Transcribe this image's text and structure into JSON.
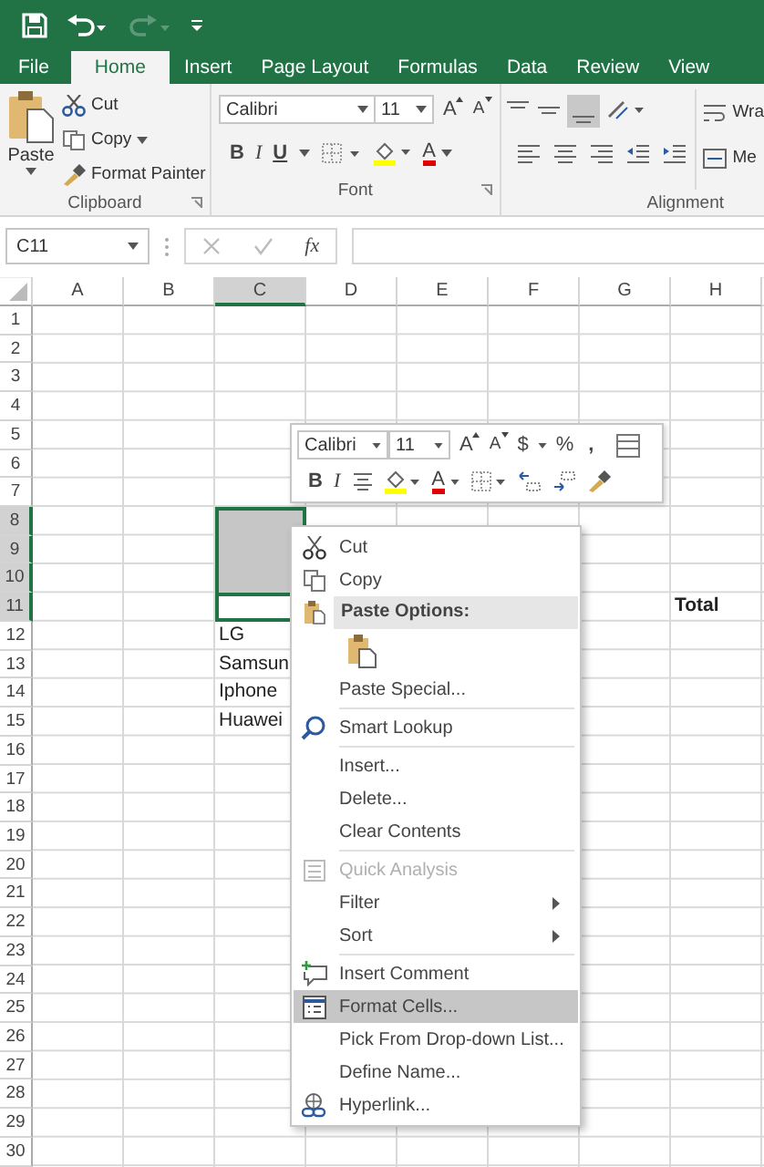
{
  "tabs": [
    {
      "label": "File",
      "selected": false
    },
    {
      "label": "Home",
      "selected": true
    },
    {
      "label": "Insert",
      "selected": false
    },
    {
      "label": "Page Layout",
      "selected": false
    },
    {
      "label": "Formulas",
      "selected": false
    },
    {
      "label": "Data",
      "selected": false
    },
    {
      "label": "Review",
      "selected": false
    },
    {
      "label": "View",
      "selected": false
    }
  ],
  "ribbon": {
    "clipboard": {
      "paste": "Paste",
      "cut": "Cut",
      "copy": "Copy",
      "format_painter": "Format Painter",
      "label": "Clipboard"
    },
    "font": {
      "font_name": "Calibri",
      "font_size": "11",
      "grow": "A",
      "shrink": "A",
      "bold": "B",
      "italic": "I",
      "underline": "U",
      "font_color": "A",
      "label": "Font"
    },
    "alignment": {
      "wrap": "Wra",
      "merge": "Me",
      "label": "Alignment"
    }
  },
  "formula_bar": {
    "name_box": "C11",
    "function": "fx"
  },
  "sheet": {
    "columns": [
      {
        "label": "A",
        "selected": false
      },
      {
        "label": "B",
        "selected": false
      },
      {
        "label": "C",
        "selected": true
      },
      {
        "label": "D",
        "selected": false
      },
      {
        "label": "E",
        "selected": false
      },
      {
        "label": "F",
        "selected": false
      },
      {
        "label": "G",
        "selected": false
      },
      {
        "label": "H",
        "selected": false
      }
    ],
    "rows": [
      {
        "number": "1",
        "selected": false
      },
      {
        "number": "2",
        "selected": false
      },
      {
        "number": "3",
        "selected": false
      },
      {
        "number": "4",
        "selected": false
      },
      {
        "number": "5",
        "selected": false
      },
      {
        "number": "6",
        "selected": false
      },
      {
        "number": "7",
        "selected": false
      },
      {
        "number": "8",
        "selected": true,
        "active": false
      },
      {
        "number": "9",
        "selected": true,
        "active": false
      },
      {
        "number": "10",
        "selected": true,
        "active": false
      },
      {
        "number": "11",
        "selected": true,
        "active": true,
        "cells": {
          "h": {
            "text": "Total",
            "bold": true
          }
        }
      },
      {
        "number": "12",
        "selected": false,
        "cells": {
          "c": {
            "text": "LG",
            "bold": false
          }
        }
      },
      {
        "number": "13",
        "selected": false,
        "cells": {
          "c": {
            "text": "Samsun",
            "bold": false
          }
        }
      },
      {
        "number": "14",
        "selected": false,
        "cells": {
          "c": {
            "text": "Iphone",
            "bold": false
          }
        }
      },
      {
        "number": "15",
        "selected": false,
        "cells": {
          "c": {
            "text": "Huawei",
            "bold": false
          }
        }
      },
      {
        "number": "16",
        "selected": false
      },
      {
        "number": "17",
        "selected": false
      },
      {
        "number": "18",
        "selected": false
      },
      {
        "number": "19",
        "selected": false
      },
      {
        "number": "20",
        "selected": false
      },
      {
        "number": "21",
        "selected": false
      },
      {
        "number": "22",
        "selected": false
      },
      {
        "number": "23",
        "selected": false
      },
      {
        "number": "24",
        "selected": false
      },
      {
        "number": "25",
        "selected": false
      },
      {
        "number": "26",
        "selected": false
      },
      {
        "number": "27",
        "selected": false
      },
      {
        "number": "28",
        "selected": false
      },
      {
        "number": "29",
        "selected": false
      },
      {
        "number": "30",
        "selected": false
      }
    ]
  },
  "mini_toolbar": {
    "font_name": "Calibri",
    "font_size": "11",
    "grow": "A",
    "shrink": "A",
    "currency": "$",
    "percent": "%",
    "comma": ",",
    "bold": "B",
    "italic": "I",
    "font_color": "A"
  },
  "context_menu": [
    {
      "kind": "item",
      "label": "Cut",
      "disabled": false,
      "submenu": false,
      "selected": false
    },
    {
      "kind": "item",
      "label": "Copy",
      "disabled": false,
      "submenu": false,
      "selected": false
    },
    {
      "kind": "header",
      "label": "Paste Options:"
    },
    {
      "kind": "paste-buttons"
    },
    {
      "kind": "item",
      "label": "Paste Special...",
      "disabled": false,
      "submenu": false,
      "selected": false
    },
    {
      "kind": "separator"
    },
    {
      "kind": "item",
      "label": "Smart Lookup",
      "disabled": false,
      "submenu": false,
      "selected": false
    },
    {
      "kind": "separator"
    },
    {
      "kind": "item",
      "label": "Insert...",
      "disabled": false,
      "submenu": false,
      "selected": false
    },
    {
      "kind": "item",
      "label": "Delete...",
      "disabled": false,
      "submenu": false,
      "selected": false
    },
    {
      "kind": "item",
      "label": "Clear Contents",
      "disabled": false,
      "submenu": false,
      "selected": false
    },
    {
      "kind": "separator"
    },
    {
      "kind": "item",
      "label": "Quick Analysis",
      "disabled": true,
      "submenu": false,
      "selected": false
    },
    {
      "kind": "item",
      "label": "Filter",
      "disabled": false,
      "submenu": true,
      "selected": false
    },
    {
      "kind": "item",
      "label": "Sort",
      "disabled": false,
      "submenu": true,
      "selected": false
    },
    {
      "kind": "separator"
    },
    {
      "kind": "item",
      "label": "Insert Comment",
      "disabled": false,
      "submenu": false,
      "selected": false
    },
    {
      "kind": "item",
      "label": "Format Cells...",
      "disabled": false,
      "submenu": false,
      "selected": true
    },
    {
      "kind": "item",
      "label": "Pick From Drop-down List...",
      "disabled": false,
      "submenu": false,
      "selected": false
    },
    {
      "kind": "item",
      "label": "Define Name...",
      "disabled": false,
      "submenu": false,
      "selected": false
    },
    {
      "kind": "item",
      "label": "Hyperlink...",
      "disabled": false,
      "submenu": false,
      "selected": false
    }
  ]
}
